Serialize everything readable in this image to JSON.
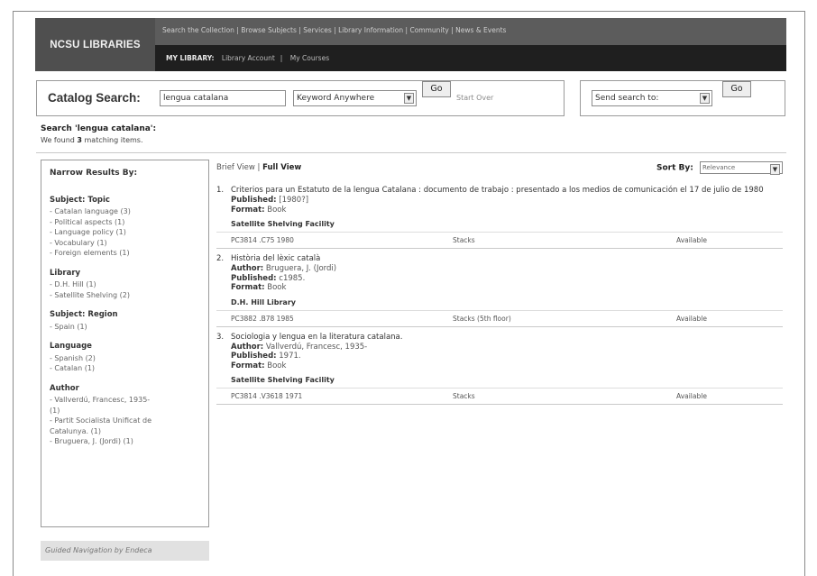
{
  "header": {
    "logo": "NCSU LIBRARIES",
    "topnav": [
      "Search the Collection",
      "Browse Subjects",
      "Services",
      "Library Information",
      "Community",
      "News & Events"
    ],
    "subnav": {
      "my_library": "MY LIBRARY:",
      "items": [
        "Library Account",
        "My Courses"
      ]
    }
  },
  "search": {
    "label": "Catalog Search:",
    "query": "lengua catalana",
    "scope": "Keyword Anywhere",
    "go_label": "Go",
    "start_over": "Start Over"
  },
  "send": {
    "value": "Send search to:",
    "go_label": "Go"
  },
  "summary": {
    "heading": "Search 'lengua catalana':",
    "found_prefix": "We found",
    "count": "3",
    "found_suffix": "matching items."
  },
  "facets": {
    "title": "Narrow Results By:",
    "groups": [
      {
        "name": "Subject: Topic",
        "items": [
          "- Catalan language (3)",
          "- Political aspects (1)",
          "- Language policy (1)",
          "- Vocabulary (1)",
          "- Foreign elements (1)"
        ]
      },
      {
        "name": "Library",
        "items": [
          "- D.H. Hill (1)",
          "- Satellite Shelving (2)"
        ]
      },
      {
        "name": "Subject: Region",
        "items": [
          "- Spain (1)"
        ]
      },
      {
        "name": "Language",
        "items": [
          "- Spanish (2)",
          "- Catalan (1)"
        ]
      },
      {
        "name": "Author",
        "items": [
          "- Vallverdú, Francesc, 1935-",
          "(1)",
          "- Partit Socialista Unificat de",
          "Catalunya. (1)",
          "- Bruguera, J. (Jordi) (1)"
        ]
      }
    ],
    "footer": "Guided Navigation by Endeca"
  },
  "results": {
    "view_brief": "Brief View",
    "view_sep": "|",
    "view_full": "Full View",
    "sort_label": "Sort By:",
    "sort_value": "Relevance",
    "items": [
      {
        "num": "1.",
        "title": "Criterios para un Estatuto de la lengua Catalana : documento de trabajo : presentado a los medios de comunicación el 17 de julio de 1980",
        "author": "",
        "published": "[1980?]",
        "format": "Book",
        "library": "Satellite Shelving Facility",
        "call_number": "PC3814 .C75 1980",
        "location": "Stacks",
        "status": "Available"
      },
      {
        "num": "2.",
        "title": "Història del lèxic català",
        "author": "Bruguera, J. (Jordi)",
        "published": "c1985.",
        "format": "Book",
        "library": "D.H. Hill Library",
        "call_number": "PC3882 .B78 1985",
        "location": "Stacks (5th floor)",
        "status": "Available"
      },
      {
        "num": "3.",
        "title": "Sociologia y lengua en la literatura catalana.",
        "author": "Vallverdú, Francesc, 1935-",
        "published": "1971.",
        "format": "Book",
        "library": "Satellite Shelving Facility",
        "call_number": "PC3814 .V3618 1971",
        "location": "Stacks",
        "status": "Available"
      }
    ],
    "labels": {
      "author": "Author:",
      "published": "Published:",
      "format": "Format:"
    }
  }
}
